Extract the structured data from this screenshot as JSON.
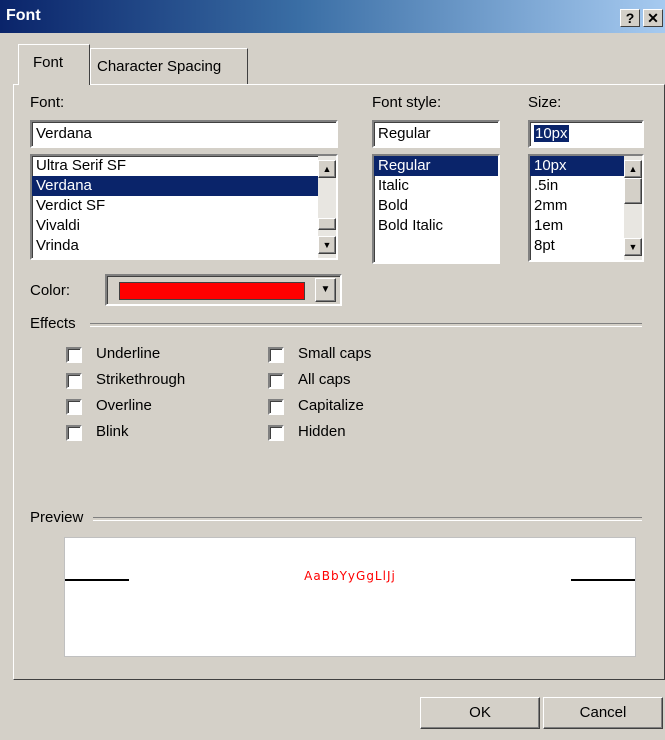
{
  "window": {
    "title": "Font",
    "help_label": "?",
    "close_label": "✕"
  },
  "tabs": [
    {
      "label": "Font"
    },
    {
      "label": "Character Spacing"
    }
  ],
  "font": {
    "label": "Font:",
    "value": "Verdana",
    "list": [
      "Ultra Serif SF",
      "Verdana",
      "Verdict SF",
      "Vivaldi",
      "Vrinda"
    ],
    "selected_index": 1
  },
  "style": {
    "label": "Font style:",
    "value": "Regular",
    "list": [
      "Regular",
      "Italic",
      "Bold",
      "Bold Italic"
    ],
    "selected_index": 0
  },
  "size": {
    "label": "Size:",
    "value": "10px",
    "list": [
      "10px",
      ".5in",
      "2mm",
      "1em",
      "8pt"
    ],
    "selected_index": 0
  },
  "color": {
    "label": "Color:",
    "value": "#ff0000"
  },
  "effects": {
    "label": "Effects",
    "left": [
      "Underline",
      "Strikethrough",
      "Overline",
      "Blink"
    ],
    "right": [
      "Small caps",
      "All caps",
      "Capitalize",
      "Hidden"
    ]
  },
  "preview": {
    "label": "Preview",
    "sample": "AaBbYyGgLlJj",
    "color": "#ff0000"
  },
  "buttons": {
    "ok": "OK",
    "cancel": "Cancel"
  },
  "icons": {
    "up": "scroll-up-arrow-icon",
    "down": "scroll-down-arrow-icon",
    "dropdown": "dropdown-arrow-icon"
  }
}
